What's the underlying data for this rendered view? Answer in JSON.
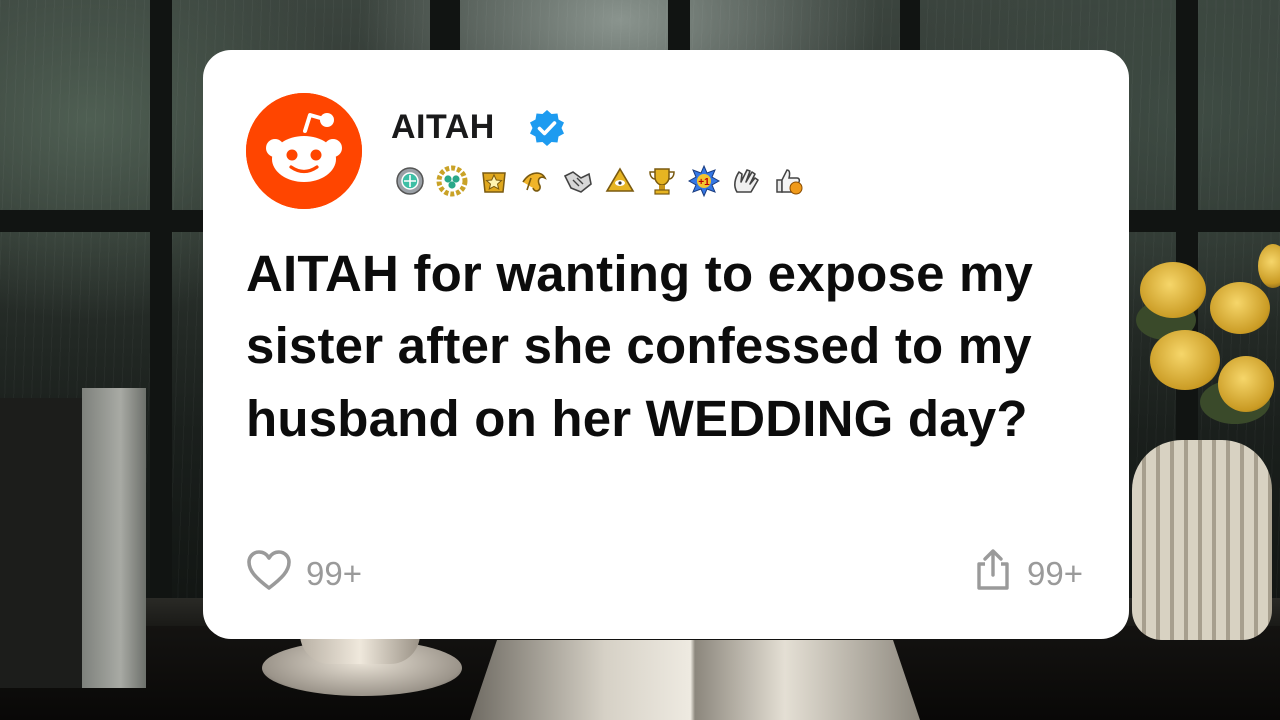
{
  "post": {
    "community": "AITAH",
    "verified_icon": "verified-check-icon",
    "award_icons": [
      "award-medal-icon",
      "award-wreath-icon",
      "award-star-icon",
      "award-takes-my-energy-icon",
      "award-handshake-icon",
      "award-pyramid-icon",
      "award-trophy-icon",
      "award-plus-one-icon",
      "award-clapping-icon",
      "award-thumbs-up-icon"
    ],
    "title": "AITAH for wanting to expose my sister after she confessed to my husband on her WEDDING day?",
    "like_count": "99+",
    "share_count": "99+"
  },
  "colors": {
    "avatar_bg": "#ff4500",
    "verified": "#1d9bf0",
    "card_bg": "#ffffff",
    "footer_text": "#9a9a9a"
  }
}
